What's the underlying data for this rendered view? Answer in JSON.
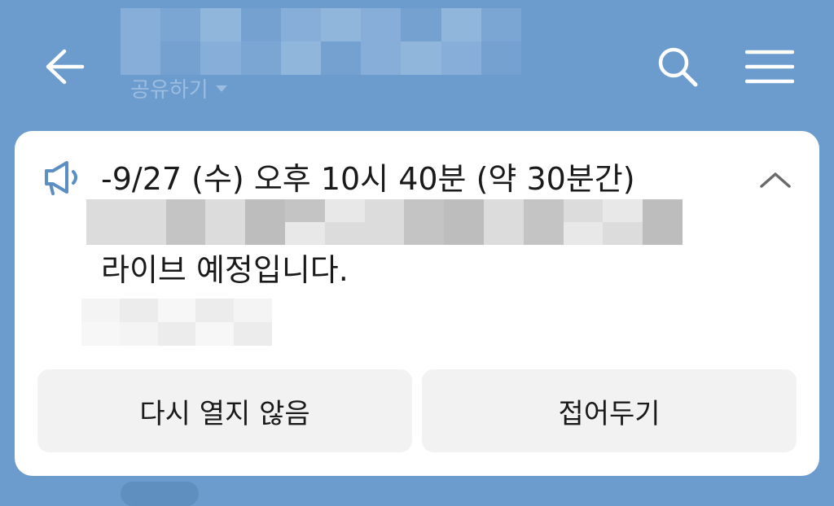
{
  "header": {
    "subtitle": "공유하기",
    "back_icon": "arrow-left-icon",
    "search_icon": "search-icon",
    "menu_icon": "hamburger-menu-icon"
  },
  "notice": {
    "icon": "megaphone-icon",
    "line1": "-9/27 (수) 오후 10시 40분 (약 30분간)",
    "line3": "라이브 예정입니다.",
    "collapse_icon": "chevron-up-icon",
    "dont_open_label": "다시 열지 않음",
    "fold_label": "접어두기"
  },
  "colors": {
    "background": "#6b9ccd",
    "card": "#ffffff",
    "button_bg": "#f2f2f2",
    "accent": "#5b8fc4"
  }
}
